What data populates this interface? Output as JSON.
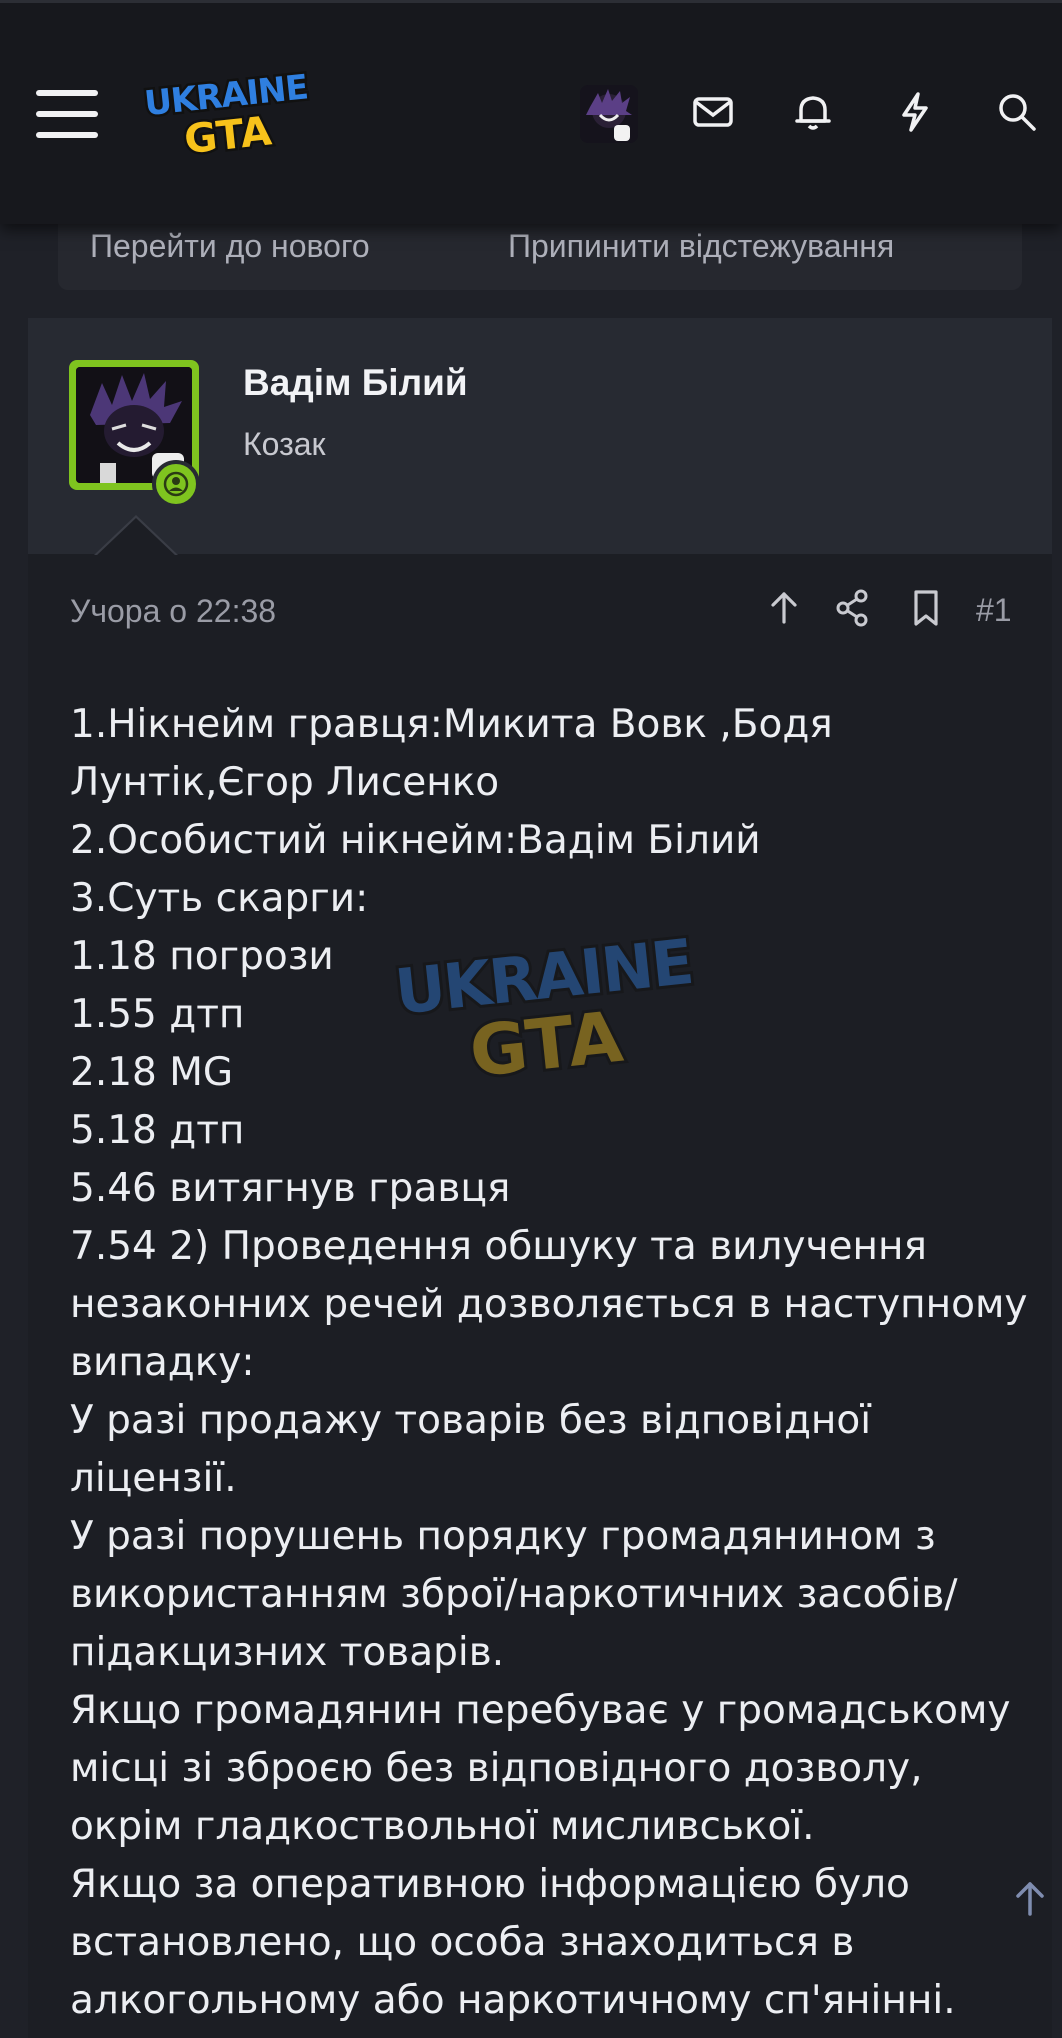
{
  "header": {
    "logo_line1": "UKRAINE",
    "logo_line2": "GTA",
    "icons": [
      "menu-icon",
      "avatar",
      "mail-icon",
      "bell-icon",
      "bolt-icon",
      "search-icon"
    ],
    "progress_fraction": 0.11
  },
  "thread_actions": {
    "go_to_new": "Перейти до нового",
    "unwatch": "Припинити відстежування"
  },
  "post": {
    "author": "Вадім Білий",
    "author_title": "Козак",
    "date": "Учора о 22:38",
    "number": "#1",
    "tool_icons": [
      "arrow-up-icon",
      "share-icon",
      "bookmark-icon"
    ],
    "body_lines": [
      "1.Нікнейм гравця:Микита Вовк ,Бодя",
      "Лунтік,Єгор Лисенко",
      "2.Особистий нікнейм:Вадім Білий",
      "3.Суть скарги:",
      "1.18 погрози",
      "1.55 дтп",
      "2.18 MG",
      "5.18 дтп",
      "5.46 витягнув гравця",
      "7.54 2) Проведення обшуку та вилучення",
      "незаконних речей дозволяється в наступному",
      "випадку:",
      "У разі продажу товарів без відповідної",
      "ліцензії.",
      "У разі порушень порядку громадянином з",
      "використанням зброї/наркотичних засобів/",
      "підакцизних товарів.",
      "Якщо громадянин перебуває у громадському",
      "місці зі зброєю без відповідного дозволу,",
      "окрім гладкоствольної мисливської.",
      "Якщо за оперативною інформацією було",
      "встановлено, що особа знаходиться в",
      "алкогольному або наркотичному сп'янінні."
    ]
  },
  "colors": {
    "accent_orange": "#f0652e",
    "avatar_green": "#7fc41f",
    "logo_blue": "#2f7fe0",
    "logo_yellow": "#f7c21b"
  }
}
